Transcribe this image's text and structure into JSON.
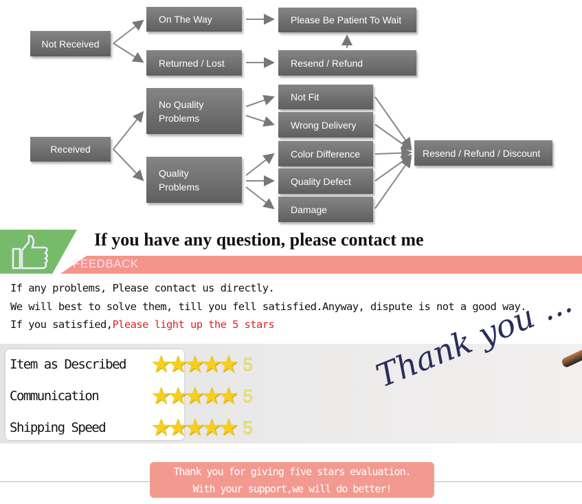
{
  "flowchart": {
    "not_received": "Not Received",
    "on_the_way": "On The Way",
    "returned_lost": "Returned / Lost",
    "please_wait": "Please Be Patient To Wait",
    "resend_refund": "Resend / Refund",
    "received": "Received",
    "no_quality_problems": "No Quality Problems",
    "quality_problems": "Quality Problems",
    "not_fit": "Not Fit",
    "wrong_delivery": "Wrong Delivery",
    "color_difference": "Color Difference",
    "quality_defect": "Quality Defect",
    "damage": "Damage",
    "resend_refund_discount": "Resend / Refund / Discount"
  },
  "banner": {
    "title": "If you have any question, please contact me",
    "feedback": "FEEDBACK",
    "icon": "thumbs-up-icon",
    "green": "#77bb6a",
    "pink": "#f4958b"
  },
  "message": {
    "line1": "If any problems, Please contact us directly.",
    "line2": "We will best to solve them, till you fell satisfied.Anyway, dispute is not a good way.",
    "line3_prefix": "If you satisfied,",
    "line3_highlight": "Please light up the 5 stars"
  },
  "ratings": [
    {
      "label": "Item as Described",
      "stars": 5,
      "score": "5"
    },
    {
      "label": "Communication",
      "stars": 5,
      "score": "5"
    },
    {
      "label": "Shipping Speed",
      "stars": 5,
      "score": "5"
    }
  ],
  "thank_you": "Thank you ...",
  "footer": {
    "line1": "Thank you for giving five stars evaluation.",
    "line2": "With your support,we will do better!"
  }
}
